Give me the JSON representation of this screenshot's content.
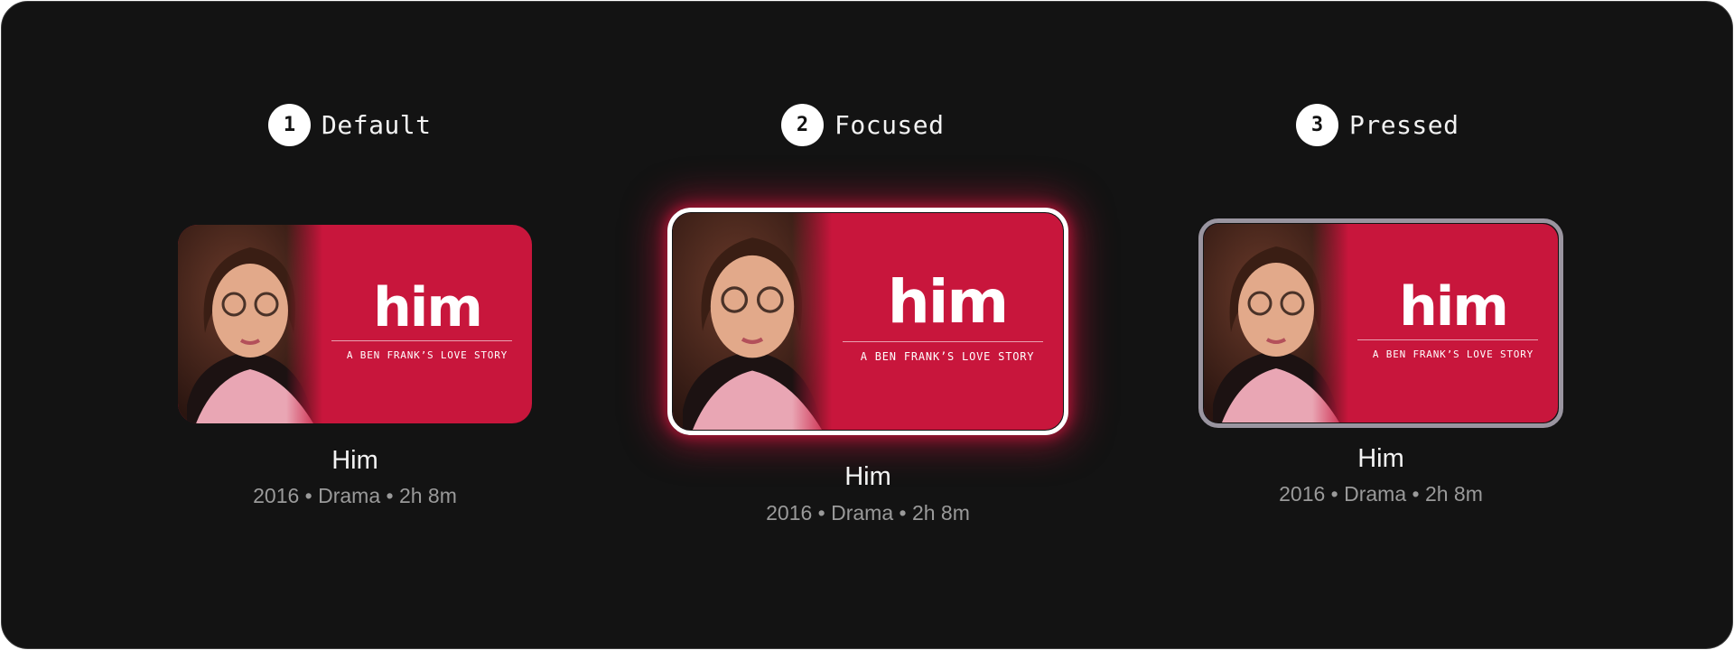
{
  "states": [
    {
      "number": "1",
      "label": "Default"
    },
    {
      "number": "2",
      "label": "Focused"
    },
    {
      "number": "3",
      "label": "Pressed"
    }
  ],
  "movie": {
    "logo": "him",
    "tagline": "A BEN FRANK’S LOVE STORY",
    "title": "Him",
    "meta": "2016 • Drama • 2h 8m"
  },
  "colors": {
    "background": "#131313",
    "poster_red": "#c8163c",
    "focus_border": "#ffffff",
    "focus_glow": "#d3163e",
    "pressed_border": "#9a95a0",
    "meta_text": "#9a9a9a"
  }
}
